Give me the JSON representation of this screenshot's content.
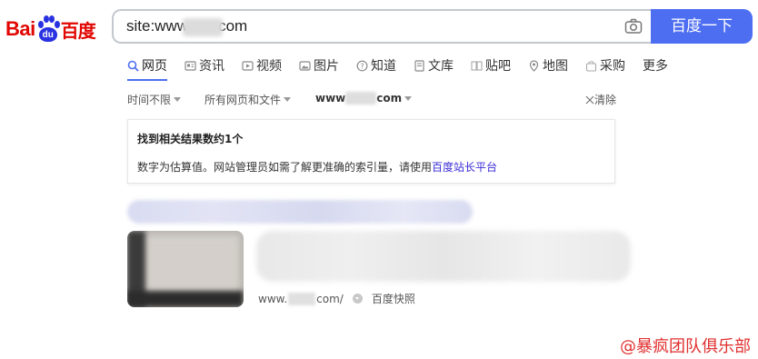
{
  "logo": {
    "text_bai": "Bai",
    "text_du": "du",
    "text_cn": "百度"
  },
  "search": {
    "query": "site:www       com",
    "button_label": "百度一下"
  },
  "tabs": [
    {
      "label": "网页",
      "icon": "search-icon"
    },
    {
      "label": "资讯",
      "icon": "news-icon"
    },
    {
      "label": "视频",
      "icon": "video-icon"
    },
    {
      "label": "图片",
      "icon": "image-icon"
    },
    {
      "label": "知道",
      "icon": "question-icon"
    },
    {
      "label": "文库",
      "icon": "document-icon"
    },
    {
      "label": "贴吧",
      "icon": "tieba-icon"
    },
    {
      "label": "地图",
      "icon": "map-icon"
    },
    {
      "label": "采购",
      "icon": "cart-icon"
    },
    {
      "label": "更多",
      "icon": ""
    }
  ],
  "filters": {
    "time": "时间不限",
    "type": "所有网页和文件",
    "site_prefix": "www",
    "site_suffix": "com",
    "clear": "清除"
  },
  "info": {
    "title": "找到相关结果数约1个",
    "desc": "数字为估算值。网站管理员如需了解更准确的索引量，请使用",
    "link": "百度站长平台"
  },
  "result": {
    "url_prefix": "www.",
    "url_suffix": "com/",
    "snapshot": "百度快照"
  },
  "watermark": "@暴疯团队俱乐部",
  "colors": {
    "brand_blue": "#4e6ef2",
    "brand_red": "#e10601"
  }
}
